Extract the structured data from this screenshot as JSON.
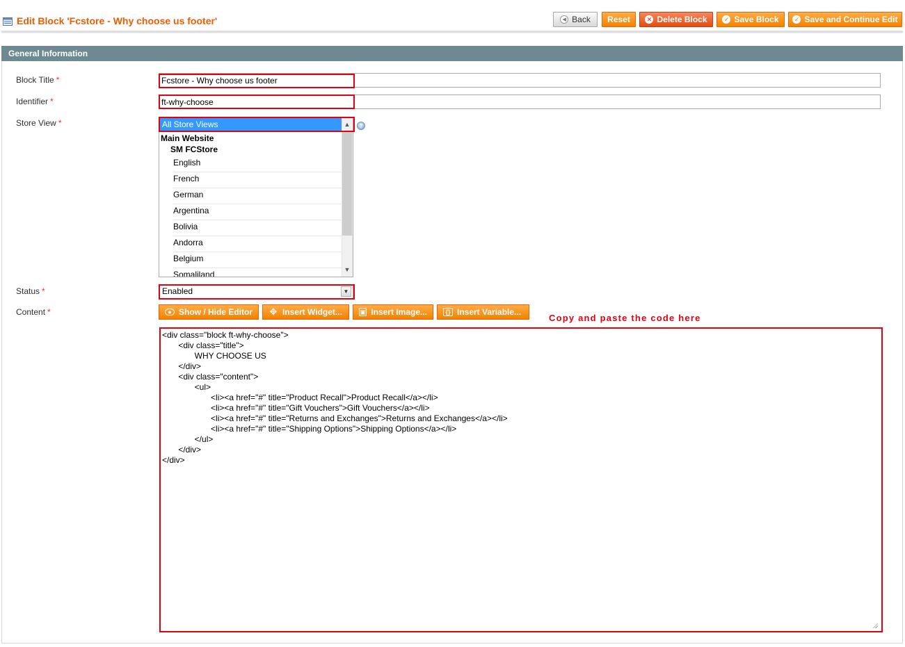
{
  "header": {
    "title": "Edit Block 'Fcstore - Why choose us footer'",
    "buttons": {
      "back": "Back",
      "reset": "Reset",
      "delete": "Delete Block",
      "save": "Save Block",
      "save_continue": "Save and Continue Edit"
    }
  },
  "fieldset": {
    "legend": "General Information"
  },
  "form": {
    "block_title": {
      "label": "Block Title",
      "required": "*",
      "value": "Fcstore - Why choose us footer"
    },
    "identifier": {
      "label": "Identifier",
      "required": "*",
      "value": "ft-why-choose"
    },
    "store_view": {
      "label": "Store View",
      "required": "*",
      "selected": "All Store Views",
      "group": "Main Website",
      "subgroup": "SM FCStore",
      "options": [
        "English",
        "French",
        "German",
        "Argentina",
        "Bolivia",
        "Andorra",
        "Belgium",
        "Somaliland"
      ]
    },
    "status": {
      "label": "Status",
      "required": "*",
      "value": "Enabled"
    },
    "content": {
      "label": "Content",
      "required": "*",
      "buttons": {
        "show_hide": "Show / Hide Editor",
        "widget": "Insert Widget...",
        "image": "Insert Image...",
        "variable": "Insert Variable..."
      },
      "code": "<div class=\"block ft-why-choose\">\n       <div class=\"title\">\n              WHY CHOOSE US\n       </div>\n       <div class=\"content\">\n              <ul>\n                     <li><a href=\"#\" title=\"Product Recall\">Product Recall</a></li>\n                     <li><a href=\"#\" title=\"Gift Vouchers\">Gift Vouchers</a></li>\n                     <li><a href=\"#\" title=\"Returns and Exchanges\">Returns and Exchanges</a></li>\n                     <li><a href=\"#\" title=\"Shipping Options\">Shipping Options</a></li>\n              </ul>\n       </div>\n</div>"
    }
  },
  "annotation": "Copy and paste the code here",
  "colors": {
    "title_orange": "#eb5e00",
    "button_orange": "#f18200",
    "fieldset_header": "#6f8992",
    "highlight_red": "#e3000f",
    "selected_blue": "#3399ff"
  }
}
